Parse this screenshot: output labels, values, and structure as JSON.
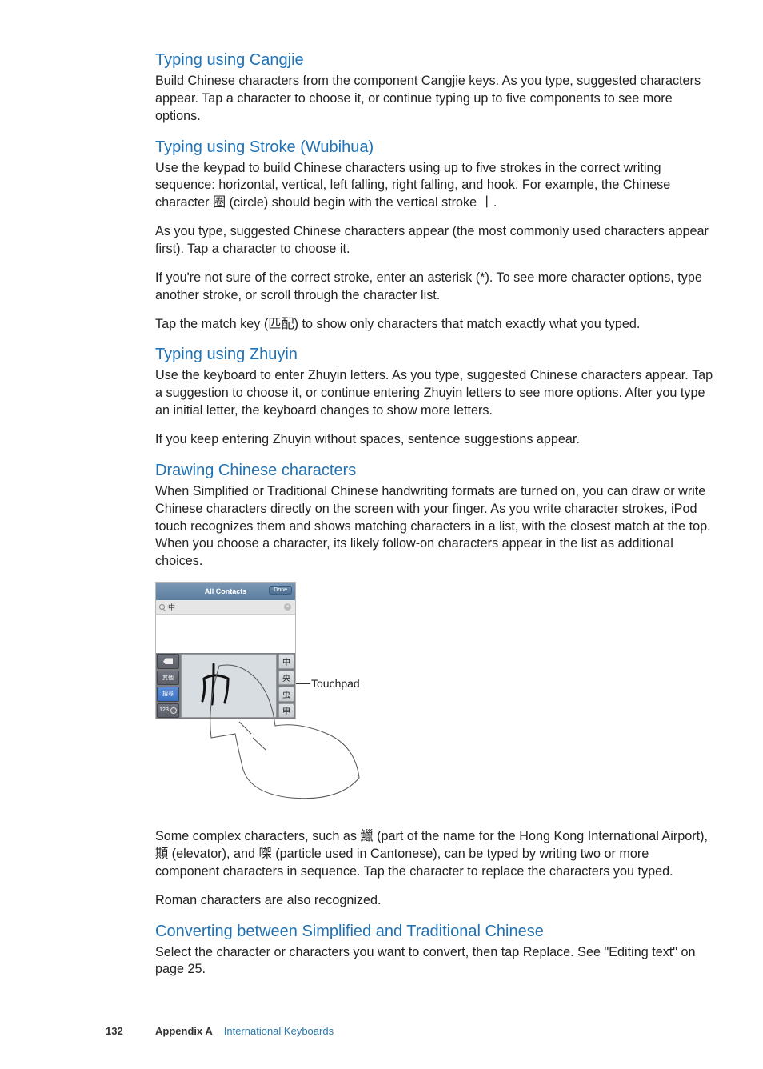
{
  "sections": {
    "cangjie": {
      "title": "Typing using Cangjie",
      "p1": "Build Chinese characters from the component Cangjie keys. As you type, suggested characters appear. Tap a character to choose it, or continue typing up to five components to see more options."
    },
    "stroke": {
      "title": "Typing using Stroke (Wubihua)",
      "p1": "Use the keypad to build Chinese characters using up to five strokes in the correct writing sequence: horizontal, vertical, left falling, right falling, and hook. For example, the Chinese character 圈 (circle) should begin with the vertical stroke 丨.",
      "p2": "As you type, suggested Chinese characters appear (the most commonly used characters appear first). Tap a character to choose it.",
      "p3": "If you're not sure of the correct stroke, enter an asterisk (*). To see more character options, type another stroke, or scroll through the character list.",
      "p4": "Tap the match key (匹配) to show only characters that match exactly what you typed."
    },
    "zhuyin": {
      "title": "Typing using Zhuyin",
      "p1": "Use the keyboard to enter Zhuyin letters. As you type, suggested Chinese characters appear. Tap a suggestion to choose it, or continue entering Zhuyin letters to see more options. After you type an initial letter, the keyboard changes to show more letters.",
      "p2": "If you keep entering Zhuyin without spaces, sentence suggestions appear."
    },
    "drawing": {
      "title": "Drawing Chinese characters",
      "p1": "When Simplified or Traditional Chinese handwriting formats are turned on, you can draw or write Chinese characters directly on the screen with your finger. As you write character strokes, iPod touch recognizes them and shows matching characters in a list, with the closest match at the top. When you choose a character, its likely follow-on characters appear in the list as additional choices.",
      "p2": "Some complex characters, such as 鱲 (part of the name for the Hong Kong International Airport), 䫏 (elevator), and 㗎 (particle used in Cantonese), can be typed by writing two or more component characters in sequence. Tap the character to replace the characters you typed.",
      "p3": "Roman characters are also recognized."
    },
    "convert": {
      "title": "Converting between Simplified and Traditional Chinese",
      "p1": "Select the character or characters you want to convert, then tap Replace. See \"Editing text\" on page 25."
    }
  },
  "figure": {
    "topbar_title": "All Contacts",
    "done_label": "Done",
    "search_value": "中",
    "callout": "Touchpad",
    "left_buttons": {
      "other": "其他",
      "search": "搜尋",
      "mode": "123"
    },
    "candidates": [
      "中",
      "央",
      "虫",
      "申"
    ]
  },
  "footer": {
    "page": "132",
    "appendix": "Appendix A",
    "chapter": "International Keyboards"
  }
}
